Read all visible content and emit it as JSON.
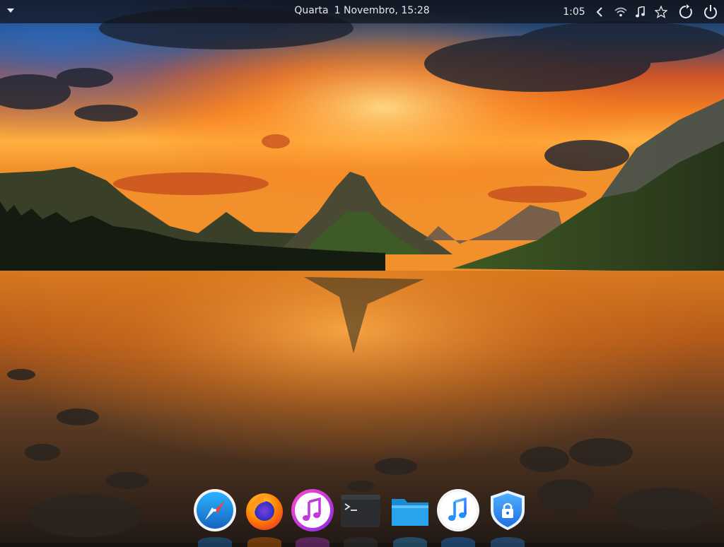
{
  "topbar": {
    "clock": {
      "day": "Quarta",
      "date": "1 Novembro, 15:28"
    },
    "tray": {
      "time_remaining": "1:05",
      "icons": [
        "chevron-left-icon",
        "wifi-icon",
        "music-note-icon",
        "star-icon",
        "restart-icon",
        "power-icon"
      ]
    }
  },
  "dock": {
    "apps": [
      {
        "icon": "safari-compass-icon",
        "accent": "#1e88e5"
      },
      {
        "icon": "firefox-icon",
        "accent": "#ff7a00"
      },
      {
        "icon": "itunes-icon",
        "accent": "#c13ad9"
      },
      {
        "icon": "terminal-icon",
        "accent": "#2b2d31"
      },
      {
        "icon": "files-folder-icon",
        "accent": "#2aa3ef"
      },
      {
        "icon": "music-icon",
        "accent": "#1e90ff"
      },
      {
        "icon": "lock-shield-icon",
        "accent": "#2f8ef0"
      }
    ],
    "terminal_prompt": ">_"
  },
  "colors": {
    "topbar_bg": "#12141a",
    "sky_orange": "#ff7a1a",
    "sky_blue": "#1f5fa8"
  }
}
